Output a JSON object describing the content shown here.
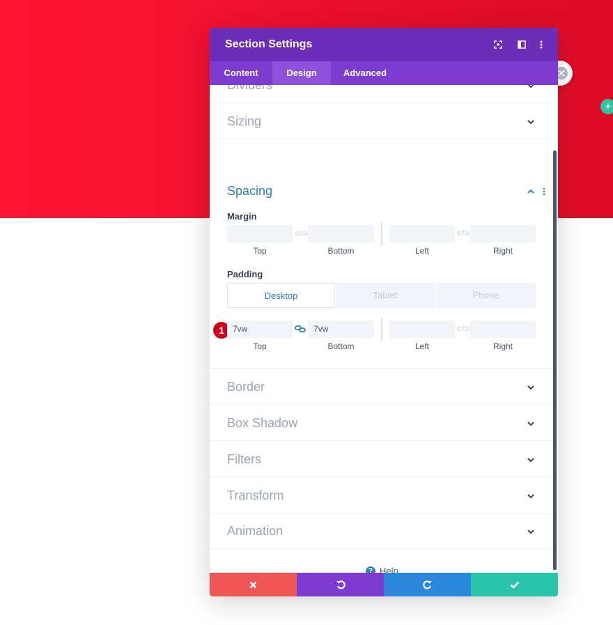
{
  "colors": {
    "hero_red": "#e80f2b",
    "header_purple": "#6c2eb9",
    "tabs_purple": "#7d3bcf",
    "active_tab": "#8e51dc",
    "accent_blue": "#2c7fb8",
    "discard_red": "#ef5555",
    "undo_purple": "#7e3bd0",
    "redo_blue": "#2b87da",
    "save_green": "#29c4a9",
    "badge_red": "#d0021b"
  },
  "modal": {
    "title": "Section Settings",
    "tabs": [
      {
        "label": "Content",
        "active": false
      },
      {
        "label": "Design",
        "active": true
      },
      {
        "label": "Advanced",
        "active": false
      }
    ],
    "header_icons": [
      "focus-icon",
      "split-view-icon",
      "kebab-menu-icon"
    ]
  },
  "sections": {
    "dividers": "Dividers",
    "sizing": "Sizing",
    "spacing": "Spacing",
    "border": "Border",
    "box_shadow": "Box Shadow",
    "filters": "Filters",
    "transform": "Transform",
    "animation": "Animation"
  },
  "spacing": {
    "margin": {
      "label": "Margin",
      "top": "",
      "bottom": "",
      "left": "",
      "right": "",
      "sublabels": {
        "top": "Top",
        "bottom": "Bottom",
        "left": "Left",
        "right": "Right"
      }
    },
    "padding": {
      "label": "Padding",
      "devices": [
        "Desktop",
        "Tablet",
        "Phone"
      ],
      "active_device": "Desktop",
      "top": "7vw",
      "bottom": "7vw",
      "left": "",
      "right": "",
      "sublabels": {
        "top": "Top",
        "bottom": "Bottom",
        "left": "Left",
        "right": "Right"
      }
    },
    "link_glyph": "⊂/⊃"
  },
  "annotation_badge": "1",
  "help_label": "Help"
}
